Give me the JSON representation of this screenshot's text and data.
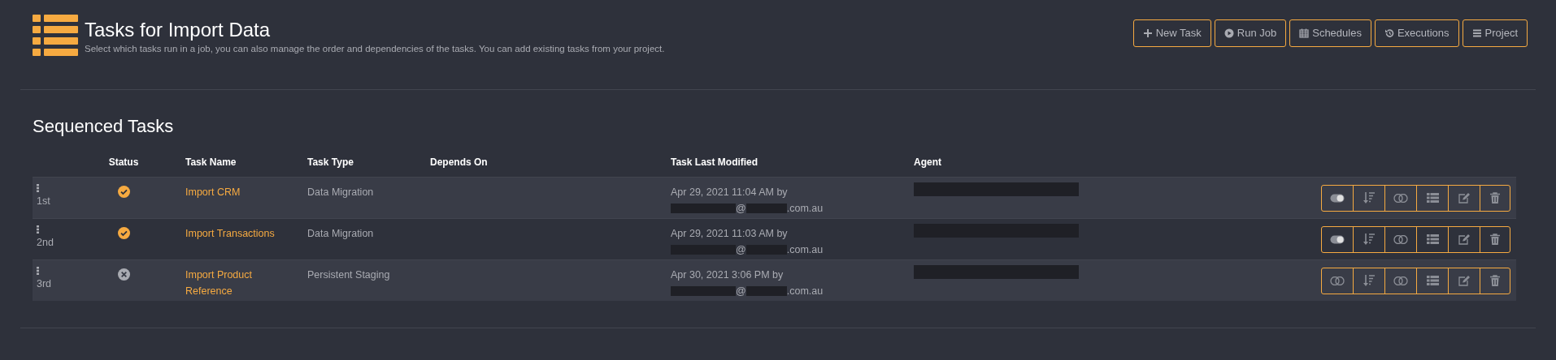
{
  "header": {
    "title": "Tasks for Import Data",
    "subtitle": "Select which tasks run in a job, you can also manage the order and dependencies of the tasks. You can add existing tasks from your project."
  },
  "toolbar": [
    {
      "kind": "plus",
      "label": "New Task"
    },
    {
      "kind": "play",
      "label": "Run Job"
    },
    {
      "kind": "calendar",
      "label": "Schedules"
    },
    {
      "kind": "history",
      "label": "Executions"
    },
    {
      "kind": "menu",
      "label": "Project"
    }
  ],
  "section": {
    "title": "Sequenced Tasks"
  },
  "table": {
    "columns": [
      "Status",
      "Task Name",
      "Task Type",
      "Depends On",
      "Task Last Modified",
      "Agent"
    ],
    "rows": [
      {
        "order": "1st",
        "succeeded": true,
        "name": "Import CRM",
        "type": "Data Migration",
        "modified": "Apr 29, 2021 11:04 AM by",
        "email_at": "@",
        "email_suffix": ".com.au",
        "enabled": true
      },
      {
        "order": "2nd",
        "succeeded": true,
        "name": "Import Transactions",
        "type": "Data Migration",
        "modified": "Apr 29, 2021 11:03 AM by",
        "email_at": "@",
        "email_suffix": ".com.au",
        "enabled": true
      },
      {
        "order": "3rd",
        "succeeded": false,
        "name": "Import Product Reference",
        "type": "Persistent Staging",
        "modified": "Apr 30, 2021 3:06 PM by",
        "email_at": "@",
        "email_suffix": ".com.au",
        "enabled": false
      }
    ]
  }
}
